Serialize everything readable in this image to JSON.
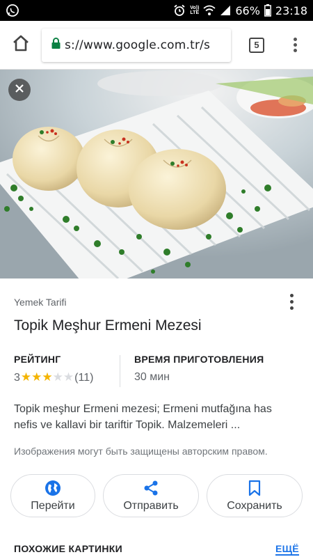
{
  "status_bar": {
    "volte_line1": "Vo))",
    "volte_line2": "LTE",
    "battery_percent": "66%",
    "time": "23:18"
  },
  "browser": {
    "url": "s://www.google.com.tr/s",
    "tab_count": "5"
  },
  "card": {
    "source": "Yemek Tarifi",
    "title": "Topik Meşhur Ermeni Mezesi",
    "rating": {
      "label": "РЕЙТИНГ",
      "value": "3",
      "stars_filled": 3,
      "stars_total": 5,
      "count": "(11)"
    },
    "cook_time": {
      "label": "ВРЕМЯ ПРИГОТОВЛЕНИЯ",
      "value": "30 мин"
    },
    "description_line1": "Topik meşhur Ermeni mezesi; Ermeni mutfağına has",
    "description_line2": "nefis ve kallavi bir tariftir Topik. Malzemeleri ...",
    "copyright": "Изображения могут быть защищены авторским правом."
  },
  "actions": {
    "visit": "Перейти",
    "share": "Отправить",
    "save": "Сохранить"
  },
  "similar": {
    "heading": "ПОХОЖИЕ КАРТИНКИ",
    "more": "ЕЩЁ"
  },
  "colors": {
    "accent": "#1a73e8",
    "star": "#f4b400",
    "share_icon": "#1a73e8"
  }
}
